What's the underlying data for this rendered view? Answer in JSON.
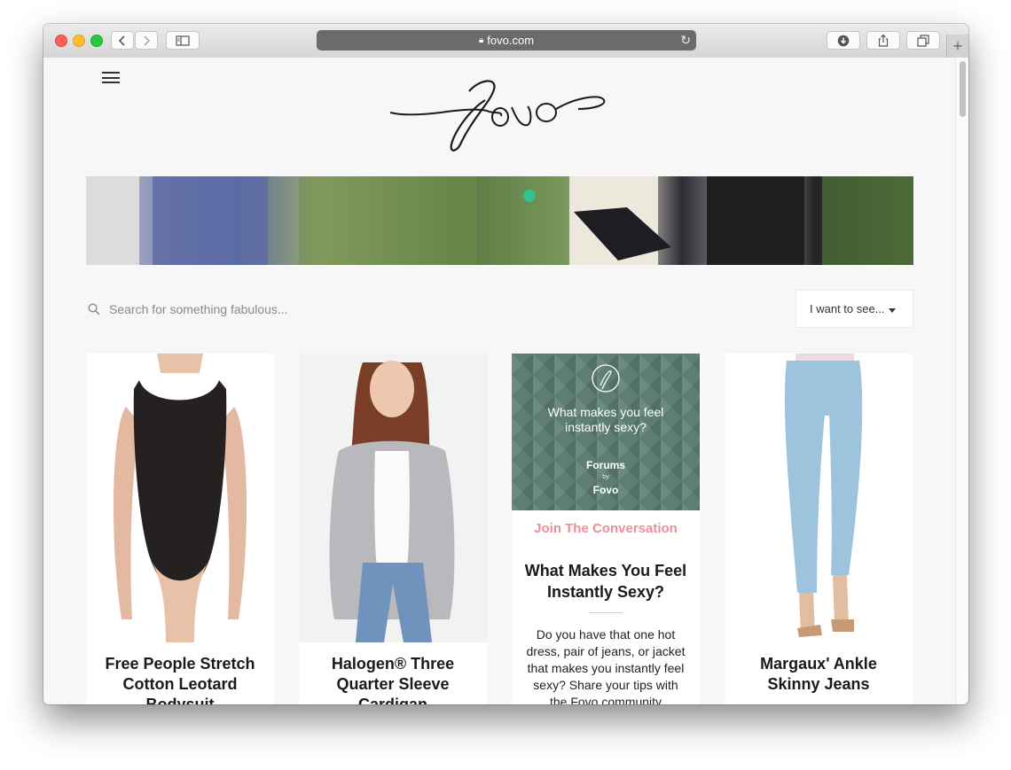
{
  "browser": {
    "url": "fovo.com",
    "icons": [
      "back-icon",
      "forward-icon",
      "sidebar-icon",
      "download-icon",
      "share-icon",
      "tabs-icon",
      "new-tab-icon",
      "lock-icon",
      "reload-icon"
    ]
  },
  "site": {
    "logo_text": "fovo",
    "search_placeholder": "Search for something fabulous...",
    "filter_label": "I want to see..."
  },
  "cards": [
    {
      "title": "Free People Stretch Cotton Leotard Bodysuit"
    },
    {
      "title": "Halogen® Three Quarter Sleeve Cardigan"
    },
    {
      "image_question": "What makes you feel instantly sexy?",
      "brand_top": "Forums",
      "brand_by": "by",
      "brand_bottom": "Fovo",
      "cta": "Join The Conversation",
      "title": "What Makes You Feel Instantly Sexy?",
      "description": "Do you have that one hot dress, pair of jeans, or jacket that makes you instantly feel sexy? Share your tips with the Fovo community"
    },
    {
      "title": "Margaux' Ankle Skinny Jeans"
    }
  ],
  "colors": {
    "accent_pink": "#ea8e98",
    "forum_green": "#5e7d73"
  }
}
